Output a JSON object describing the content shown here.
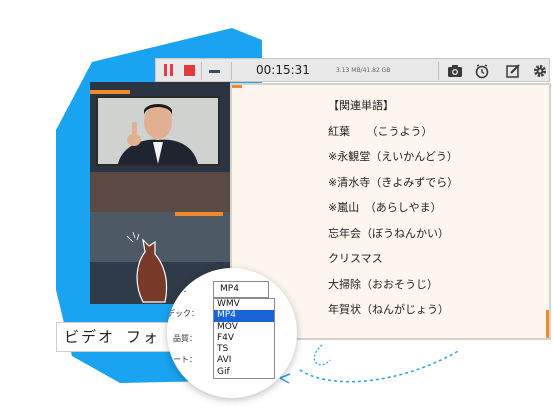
{
  "toolbar": {
    "timer": "00:15:31",
    "filesize": "3.13 MB/41.82 GB",
    "icons": [
      "pause-icon",
      "stop-icon",
      "minimize-icon",
      "camera-icon",
      "clock-icon",
      "edit-icon",
      "gear-icon"
    ]
  },
  "document": {
    "lines": [
      "【関連単語】",
      "紅葉　　（こうよう）",
      "※永観堂（えいかんどう）",
      "※清水寺（きよみずでら）",
      "※嵐山　（あらしやま）",
      "忘年会（ぼうねんかい）",
      "クリスマス",
      "大掃除（おおそうじ）",
      "年賀状（ねんがじょう）"
    ]
  },
  "title_strip": "ビデオ フォ",
  "magnifier": {
    "format_label": "ト：",
    "codec_label": "デック：",
    "quality_label": "品質：",
    "rate_label": "ート：",
    "selected_format": "MP4",
    "format_options": [
      "WMV",
      "MP4",
      "MOV",
      "F4V",
      "TS",
      "AVI",
      "Gif"
    ],
    "highlighted": "MP4"
  },
  "colors": {
    "blob": "#1aa3f0",
    "accent_orange": "#f28a2a",
    "selection_blue": "#1a63d6",
    "stop_red": "#e23a3a"
  }
}
